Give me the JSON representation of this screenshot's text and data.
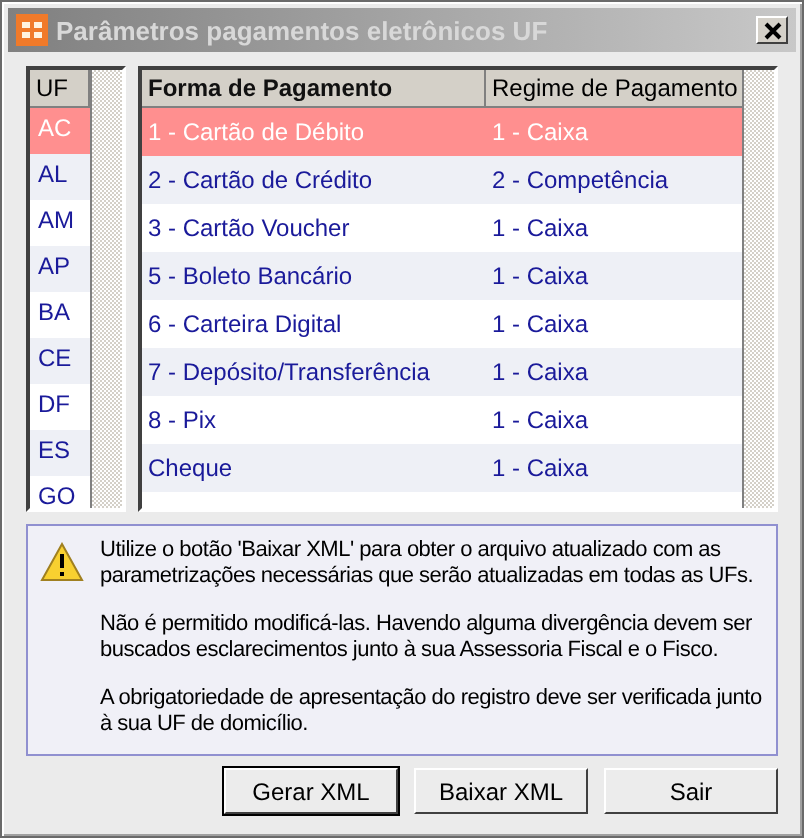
{
  "window": {
    "title": "Parâmetros pagamentos eletrônicos UF"
  },
  "uf_list": {
    "header": "UF",
    "items": [
      {
        "label": "AC",
        "selected": true
      },
      {
        "label": "AL",
        "selected": false
      },
      {
        "label": "AM",
        "selected": false
      },
      {
        "label": "AP",
        "selected": false
      },
      {
        "label": "BA",
        "selected": false
      },
      {
        "label": "CE",
        "selected": false
      },
      {
        "label": "DF",
        "selected": false
      },
      {
        "label": "ES",
        "selected": false
      },
      {
        "label": "GO",
        "selected": false
      }
    ]
  },
  "payment_grid": {
    "columns": [
      {
        "label": "Forma de Pagamento",
        "active": true
      },
      {
        "label": "Regime de Pagamento",
        "active": false
      }
    ],
    "rows": [
      {
        "cells": [
          "1 - Cartão de Débito",
          "1 - Caixa"
        ],
        "selected": true
      },
      {
        "cells": [
          "2 - Cartão de Crédito",
          "2 - Competência"
        ],
        "selected": false
      },
      {
        "cells": [
          "3 - Cartão Voucher",
          "1 - Caixa"
        ],
        "selected": false
      },
      {
        "cells": [
          "5 - Boleto Bancário",
          "1 - Caixa"
        ],
        "selected": false
      },
      {
        "cells": [
          "6 - Carteira Digital",
          "1 - Caixa"
        ],
        "selected": false
      },
      {
        "cells": [
          "7 - Depósito/Transferência",
          "1 - Caixa"
        ],
        "selected": false
      },
      {
        "cells": [
          "8 - Pix",
          "1 - Caixa"
        ],
        "selected": false
      },
      {
        "cells": [
          "Cheque",
          "1 - Caixa"
        ],
        "selected": false
      }
    ]
  },
  "notice": {
    "paragraphs": [
      "Utilize o botão 'Baixar XML' para obter o arquivo atualizado com as parametrizações necessárias que serão atualizadas em todas as UFs.",
      "Não é permitido modificá-las. Havendo alguma divergência devem ser buscados esclarecimentos junto à sua Assessoria Fiscal e o Fisco.",
      "A obrigatoriedade de apresentação do registro deve ser verificada junto à sua UF de domicílio."
    ]
  },
  "buttons": [
    {
      "label": "Gerar XML",
      "default": true
    },
    {
      "label": "Baixar XML",
      "default": false
    },
    {
      "label": "Sair",
      "default": false
    }
  ]
}
